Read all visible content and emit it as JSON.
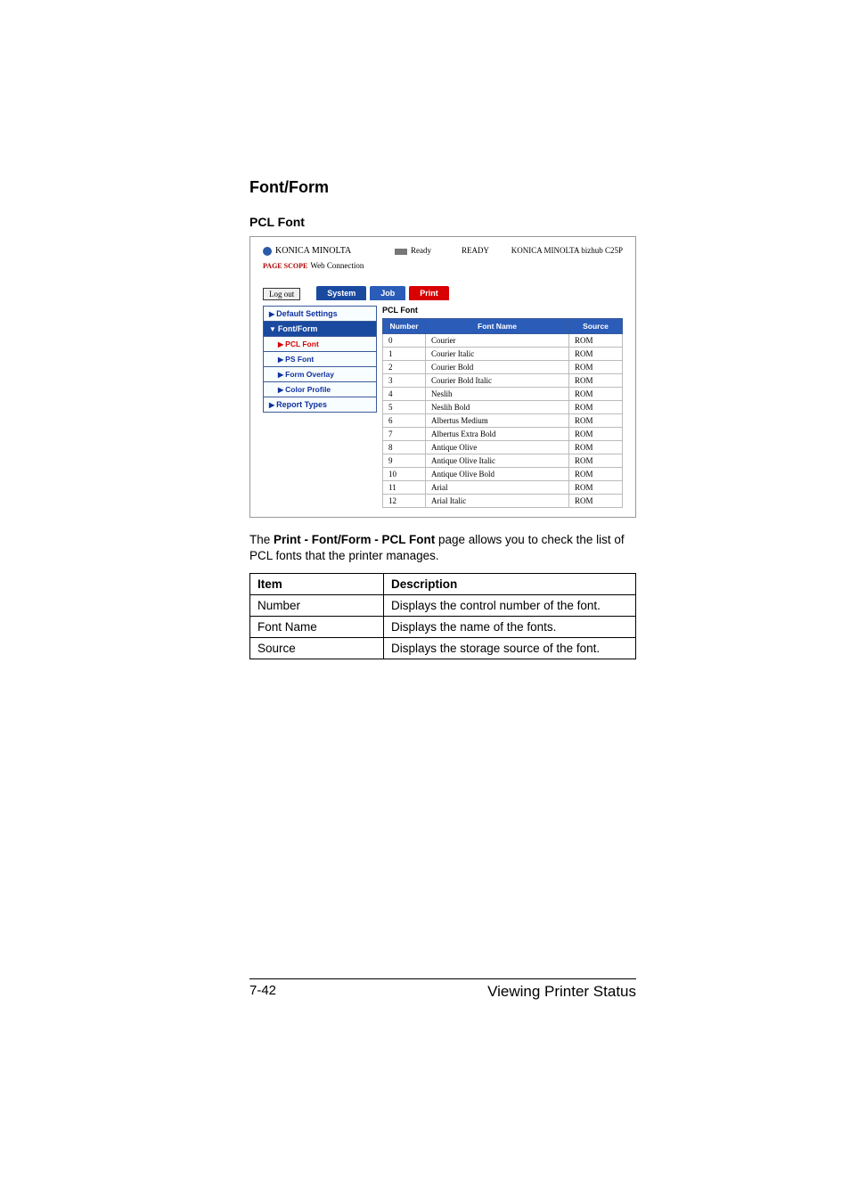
{
  "headings": {
    "h1": "Font/Form",
    "h2": "PCL Font"
  },
  "screenshot": {
    "brand": "KONICA MINOLTA",
    "subbrand_prefix": "PAGE SCOPE",
    "subbrand": "Web Connection",
    "ready_small": "Ready",
    "ready_big": "READY",
    "device": "KONICA MINOLTA bizhub C25P",
    "logout": "Log out",
    "tabs": {
      "system": "System",
      "job": "Job",
      "print": "Print"
    },
    "sidebar": {
      "default_settings": "Default Settings",
      "font_form": "Font/Form",
      "pcl_font": "PCL Font",
      "ps_font": "PS Font",
      "form_overlay": "Form Overlay",
      "color_profile": "Color Profile",
      "report_types": "Report Types"
    },
    "main_title": "PCL Font",
    "th": {
      "number": "Number",
      "font_name": "Font Name",
      "source": "Source"
    },
    "rows": [
      {
        "n": "0",
        "name": "Courier",
        "src": "ROM"
      },
      {
        "n": "1",
        "name": "Courier Italic",
        "src": "ROM"
      },
      {
        "n": "2",
        "name": "Courier Bold",
        "src": "ROM"
      },
      {
        "n": "3",
        "name": "Courier Bold Italic",
        "src": "ROM"
      },
      {
        "n": "4",
        "name": "Neslih",
        "src": "ROM"
      },
      {
        "n": "5",
        "name": "Neslih Bold",
        "src": "ROM"
      },
      {
        "n": "6",
        "name": "Albertus Medium",
        "src": "ROM"
      },
      {
        "n": "7",
        "name": "Albertus Extra Bold",
        "src": "ROM"
      },
      {
        "n": "8",
        "name": "Antique Olive",
        "src": "ROM"
      },
      {
        "n": "9",
        "name": "Antique Olive Italic",
        "src": "ROM"
      },
      {
        "n": "10",
        "name": "Antique Olive Bold",
        "src": "ROM"
      },
      {
        "n": "11",
        "name": "Arial",
        "src": "ROM"
      },
      {
        "n": "12",
        "name": "Arial Italic",
        "src": "ROM"
      }
    ]
  },
  "body_text": {
    "prefix": "The ",
    "bold": "Print - Font/Form - PCL Font",
    "suffix": " page allows you to check the list of PCL fonts that the printer manages."
  },
  "desc_table": {
    "head": {
      "item": "Item",
      "desc": "Description"
    },
    "rows": [
      {
        "item": "Number",
        "desc": "Displays the control number of the font."
      },
      {
        "item": "Font Name",
        "desc": "Displays the name of the fonts."
      },
      {
        "item": "Source",
        "desc": "Displays the storage source of the font."
      }
    ]
  },
  "footer": {
    "page": "7-42",
    "title": "Viewing Printer Status"
  }
}
